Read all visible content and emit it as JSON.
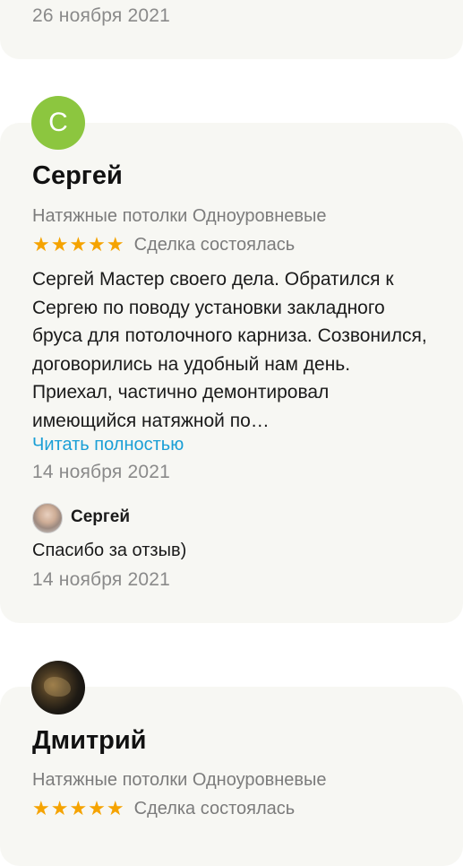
{
  "reviews": [
    {
      "date": "26 ноября 2021"
    },
    {
      "avatar_letter": "С",
      "avatar_color": "#8cc63f",
      "name": "Сергей",
      "category": "Натяжные потолки Одноуровневые",
      "rating": 5,
      "stars": "★★★★★",
      "deal_status": "Сделка состоялась",
      "text": "Сергей Мастер своего дела. Обратился к Сергею по поводу установки закладного бруса для потолочного карниза. Созвонился, договорились на удобный нам день. Приехал, частично демонтировал имеющийся натяжной по…",
      "read_more": "Читать полностью",
      "date": "14 ноября 2021",
      "reply": {
        "name": "Сергей",
        "text": "Спасибо за отзыв)",
        "date": "14 ноября 2021"
      }
    },
    {
      "name": "Дмитрий",
      "category": "Натяжные потолки Одноуровневые",
      "rating": 5,
      "stars": "★★★★★",
      "deal_status": "Сделка состоялась"
    }
  ],
  "colors": {
    "accent_link": "#1a9fd6",
    "star": "#f5a300",
    "card_bg": "#f7f7f3"
  }
}
